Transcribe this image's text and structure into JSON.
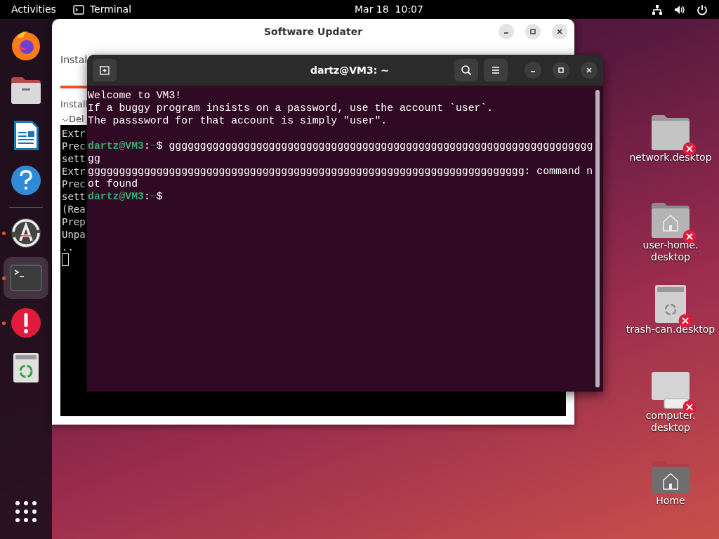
{
  "top_bar": {
    "activities": "Activities",
    "app_name": "Terminal",
    "clock": "Mar 18  10:07"
  },
  "dock": [
    {
      "kind": "firefox",
      "running": false,
      "selected": false
    },
    {
      "kind": "files",
      "running": false,
      "selected": false
    },
    {
      "kind": "writer",
      "running": false,
      "selected": false
    },
    {
      "kind": "help",
      "running": false,
      "selected": false
    },
    {
      "kind": "separator"
    },
    {
      "kind": "updater",
      "running": true,
      "selected": false
    },
    {
      "kind": "terminal",
      "running": true,
      "selected": true
    },
    {
      "kind": "error",
      "running": true,
      "selected": false
    },
    {
      "kind": "trash",
      "running": false,
      "selected": false
    }
  ],
  "software_updater": {
    "title": "Software Updater",
    "heading": "Instal",
    "progress": {
      "level": 0.06
    },
    "status": "Install",
    "details_toggle": "Del",
    "log": [
      "Extr",
      "Prec",
      "sett",
      "Extr",
      "Prec",
      "sett",
      "(Rea",
      "Prep",
      "Unpa",
      ".."
    ]
  },
  "terminal": {
    "title": "dartz@VM3: ~",
    "lines": [
      {
        "kind": "output",
        "text": "Welcome to VM3!"
      },
      {
        "kind": "output",
        "text": "If a buggy program insists on a password, use the account `user`."
      },
      {
        "kind": "output",
        "text": "The passsword for that account is simply \"user\"."
      },
      {
        "kind": "blank"
      },
      {
        "kind": "prompt",
        "user": "dartz@VM3",
        "separator": ":",
        "path": "~",
        "symbol": "$",
        "text": "gggggggggggggggggggggggggggggggggggggggggggggggggggggggggggggggggggg"
      },
      {
        "kind": "output",
        "text": "gg"
      },
      {
        "kind": "output",
        "text": "gggggggggggggggggggggggggggggggggggggggggggggggggggggggggggggggggggggg: command n"
      },
      {
        "kind": "output",
        "text": "ot found"
      },
      {
        "kind": "prompt",
        "user": "dartz@VM3",
        "separator": ":",
        "path": "~",
        "symbol": "$"
      }
    ]
  },
  "desktop_icons": [
    {
      "kind": "folder",
      "broken": true,
      "label": [
        "network.desktop"
      ]
    },
    {
      "kind": "home-folder",
      "broken": true,
      "label": [
        "user-home.",
        "desktop"
      ]
    },
    {
      "kind": "trash",
      "broken": true,
      "label": [
        "trash-can.desktop"
      ]
    },
    {
      "kind": "computer",
      "broken": true,
      "label": [
        "computer.",
        "desktop"
      ]
    },
    {
      "kind": "home",
      "broken": false,
      "label": [
        "Home"
      ]
    }
  ]
}
